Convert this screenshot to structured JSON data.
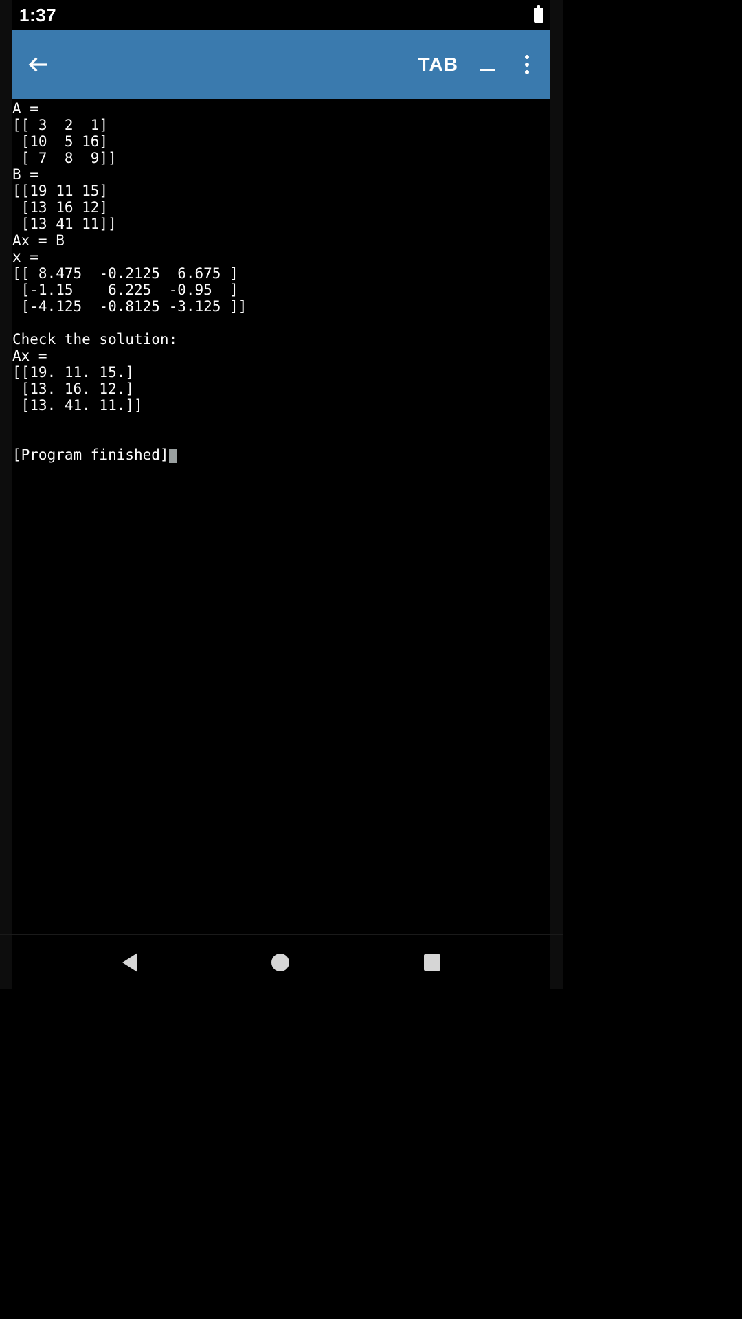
{
  "status": {
    "time": "1:37"
  },
  "appbar": {
    "tab_label": "TAB"
  },
  "terminal": {
    "line1": "A =",
    "line2": "[[ 3  2  1]",
    "line3": " [10  5 16]",
    "line4": " [ 7  8  9]]",
    "line5": "B =",
    "line6": "[[19 11 15]",
    "line7": " [13 16 12]",
    "line8": " [13 41 11]]",
    "line9": "Ax = B",
    "line10": "x =",
    "line11": "[[ 8.475  -0.2125  6.675 ]",
    "line12": " [-1.15    6.225  -0.95  ]",
    "line13": " [-4.125  -0.8125 -3.125 ]]",
    "blank1": "",
    "line14": "Check the solution:",
    "line15": "Ax =",
    "line16": "[[19. 11. 15.]",
    "line17": " [13. 16. 12.]",
    "line18": " [13. 41. 11.]]",
    "blank2": "",
    "blank3": "",
    "finished": "[Program finished]"
  }
}
